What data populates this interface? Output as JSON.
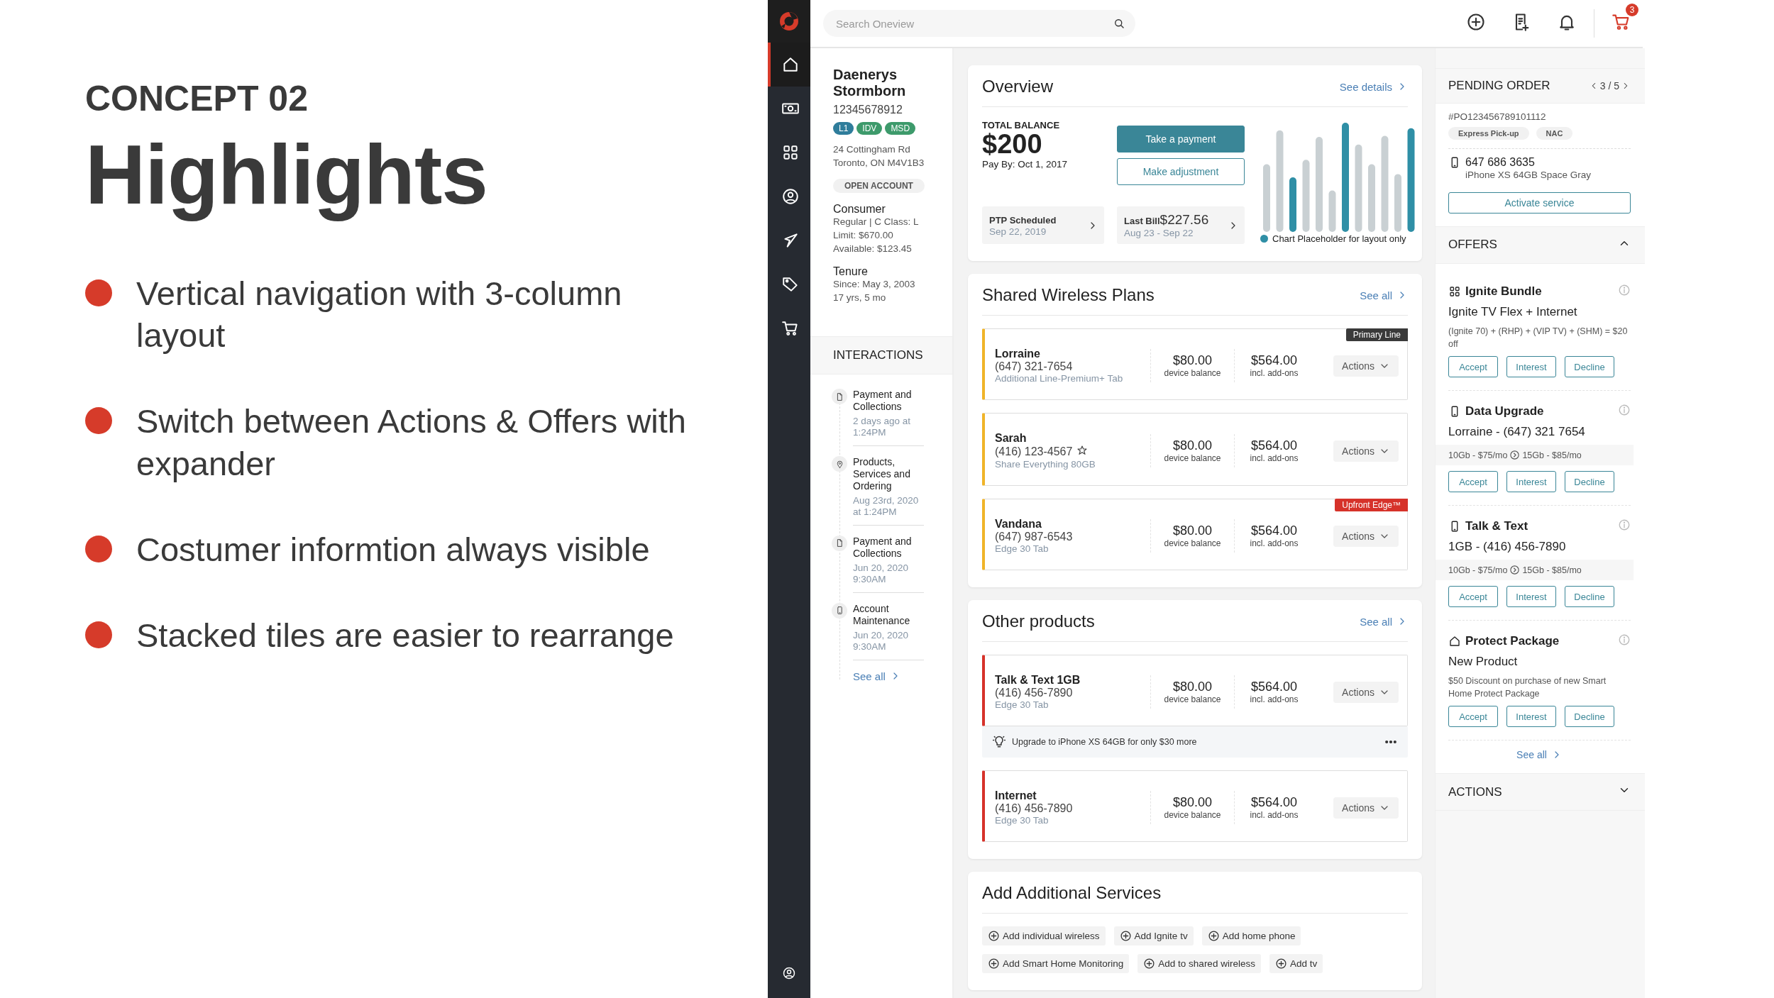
{
  "slide": {
    "eyebrow": "CONCEPT 02",
    "title": "Highlights",
    "bullets": [
      "Vertical navigation with 3-column layout",
      "Switch between Actions & Offers with expander",
      "Costumer informtion always visible",
      "Stacked tiles are easier to rearrange"
    ]
  },
  "nav": {
    "items": [
      {
        "selected": true
      },
      {
        "selected": false
      },
      {
        "selected": false
      },
      {
        "selected": false
      },
      {
        "selected": false
      },
      {
        "selected": false
      },
      {
        "selected": false
      }
    ]
  },
  "topbar": {
    "search": {
      "placeholder": "Search Oneview"
    },
    "cart_count": "3"
  },
  "customer": {
    "name": "Daenerys Stormborn",
    "account": "12345678912",
    "tags": [
      {
        "label": "L1",
        "color": "#2f7d9b"
      },
      {
        "label": "IDV",
        "color": "#3d9a6b"
      },
      {
        "label": "MSD",
        "color": "#3d9a6b"
      }
    ],
    "address": [
      "24 Cottingham Rd",
      "Toronto, ON M4V1B3"
    ],
    "status": "OPEN ACCOUNT",
    "sections": [
      {
        "title": "Consumer",
        "lines": [
          "Regular | C Class: L",
          "Limit: $670.00",
          "Available: $123.45"
        ]
      },
      {
        "title": "Tenure",
        "lines": [
          "Since: May 3, 2003",
          "17 yrs, 5 mo"
        ]
      }
    ]
  },
  "interactions": {
    "title": "INTERACTIONS",
    "items": [
      {
        "kind": "document",
        "title": "Payment and Collections",
        "time": "2 days ago at 1:24PM"
      },
      {
        "kind": "location",
        "title": "Products, Services and Ordering",
        "time": "Aug 23rd, 2020 at 1:24PM"
      },
      {
        "kind": "document",
        "title": "Payment and Collections",
        "time": "Jun 20, 2020 9:30AM"
      },
      {
        "kind": "device",
        "title": "Account Maintenance",
        "time": "Jun 20, 2020 9:30AM"
      }
    ],
    "see_all": "See all"
  },
  "overview": {
    "title": "Overview",
    "link": "See details",
    "balance_label": "TOTAL BALANCE",
    "balance": "$200",
    "pay_by": "Pay By: Oct 1, 2017",
    "buttons": [
      {
        "label": "Take a payment",
        "kind": "primary"
      },
      {
        "label": "Make adjustment",
        "kind": "outline"
      }
    ],
    "tiles": [
      {
        "label": "PTP Scheduled",
        "sub": "Sep 22, 2019"
      },
      {
        "label": "Last Bill",
        "amount": "$227.56",
        "sub": "Aug 23 - Sep 22"
      }
    ],
    "chart_legend": "Chart Placeholder for layout only"
  },
  "shared_plans": {
    "title": "Shared Wireless Plans",
    "link": "See all",
    "lines": [
      {
        "name": "Lorraine",
        "phone": "(647) 321-7654",
        "starred": false,
        "plan": "Additional Line-Premium+ Tab",
        "badge": {
          "text": "Primary Line",
          "kind": "primary"
        },
        "device_balance": "$80.00",
        "device_label": "device balance",
        "addons": "$564.00",
        "addons_label": "incl. add-ons",
        "action": "Actions"
      },
      {
        "name": "Sarah",
        "phone": "(416) 123-4567",
        "starred": true,
        "plan": "Share Everything 80GB",
        "device_balance": "$80.00",
        "device_label": "device balance",
        "addons": "$564.00",
        "addons_label": "incl. add-ons",
        "action": "Actions"
      },
      {
        "name": "Vandana",
        "phone": "(647) 987-6543",
        "starred": false,
        "plan": "Edge 30 Tab",
        "badge": {
          "text": "Upfront Edge™",
          "kind": "promo"
        },
        "device_balance": "$80.00",
        "device_label": "device balance",
        "addons": "$564.00",
        "addons_label": "incl. add-ons",
        "action": "Actions"
      }
    ]
  },
  "other_products": {
    "title": "Other products",
    "link": "See all",
    "lines": [
      {
        "name": "Talk & Text 1GB",
        "phone": "(416) 456-7890",
        "starred": false,
        "plan": "Edge 30 Tab",
        "device_balance": "$80.00",
        "device_label": "device balance",
        "addons": "$564.00",
        "addons_label": "incl. add-ons",
        "action": "Actions",
        "tip": "Upgrade to iPhone XS 64GB for only $30 more"
      },
      {
        "name": "Internet",
        "phone": "(416) 456-7890",
        "starred": false,
        "plan": "Edge 30 Tab",
        "device_balance": "$80.00",
        "device_label": "device balance",
        "addons": "$564.00",
        "addons_label": "incl. add-ons",
        "action": "Actions"
      }
    ]
  },
  "services": {
    "title": "Add Additional Services",
    "items": [
      "Add individual wireless",
      "Add Ignite tv",
      "Add home phone",
      "Add Smart Home Monitoring",
      "Add to shared wireless",
      "Add tv"
    ]
  },
  "pending_order": {
    "title": "PENDING ORDER",
    "pager": "3 / 5",
    "order": "#PO123456789101112",
    "tags": [
      "Express Pick-up",
      "NAC"
    ],
    "phone": "647 686 3635",
    "device": "iPhone XS 64GB Space Gray",
    "button": "Activate service"
  },
  "offers": {
    "title": "OFFERS",
    "expanded": true,
    "items": [
      {
        "kind": "text",
        "title": "Ignite Bundle",
        "subtitle": "Ignite TV Flex + Internet",
        "detail": "(Ignite 70) + (RHP) + (VIP TV) + (SHM) = $20 off",
        "buttons": [
          "Accept",
          "Interest",
          "Decline"
        ]
      },
      {
        "kind": "upgrade",
        "title": "Data Upgrade",
        "subtitle": "Lorraine - (647) 321 7654",
        "from": "10Gb - $75/mo",
        "to": "15Gb - $85/mo",
        "buttons": [
          "Accept",
          "Interest",
          "Decline"
        ]
      },
      {
        "kind": "upgrade",
        "title": "Talk & Text",
        "subtitle": "1GB - (416) 456-7890",
        "from": "10Gb - $75/mo",
        "to": "15Gb - $85/mo",
        "buttons": [
          "Accept",
          "Interest",
          "Decline"
        ]
      },
      {
        "kind": "text",
        "title": "Protect Package",
        "subtitle": "New Product",
        "detail": "$50 Discount on purchase of new Smart Home Protect Package",
        "buttons": [
          "Accept",
          "Interest",
          "Decline"
        ]
      }
    ],
    "see_all": "See all"
  },
  "actions": {
    "title": "ACTIONS",
    "expanded": false
  }
}
